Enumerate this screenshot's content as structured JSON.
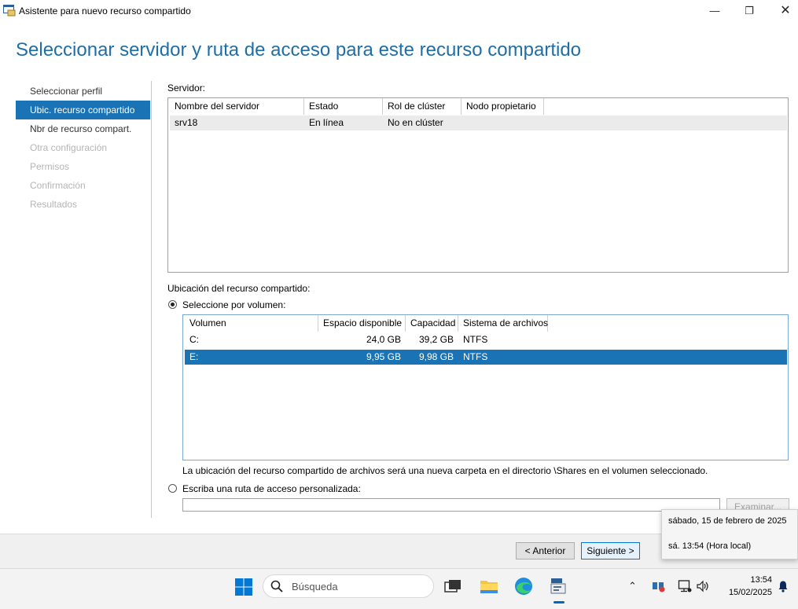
{
  "window": {
    "title": "Asistente para nuevo recurso compartido",
    "controls": {
      "minimize": "—",
      "maximize": "❐",
      "close": "✕"
    }
  },
  "header": {
    "title": "Seleccionar servidor y ruta de acceso para este recurso compartido"
  },
  "nav": {
    "items": [
      {
        "label": "Seleccionar perfil",
        "state": "normal"
      },
      {
        "label": "Ubic. recurso compartido",
        "state": "active"
      },
      {
        "label": "Nbr de recurso compart.",
        "state": "normal"
      },
      {
        "label": "Otra configuración",
        "state": "disabled"
      },
      {
        "label": "Permisos",
        "state": "disabled"
      },
      {
        "label": "Confirmación",
        "state": "disabled"
      },
      {
        "label": "Resultados",
        "state": "disabled"
      }
    ]
  },
  "server": {
    "label": "Servidor:",
    "columns": [
      "Nombre del servidor",
      "Estado",
      "Rol de clúster",
      "Nodo propietario"
    ],
    "rows": [
      [
        "srv18",
        "En línea",
        "No en clúster",
        ""
      ]
    ]
  },
  "location": {
    "label": "Ubicación del recurso compartido:",
    "by_volume_label": "Seleccione por volumen:",
    "by_volume_selected": true,
    "volume_columns": [
      "Volumen",
      "Espacio disponible",
      "Capacidad",
      "Sistema de archivos"
    ],
    "volumes": [
      {
        "volume": "C:",
        "free": "24,0 GB",
        "capacity": "39,2 GB",
        "fs": "NTFS",
        "selected": false
      },
      {
        "volume": "E:",
        "free": "9,95 GB",
        "capacity": "9,98 GB",
        "fs": "NTFS",
        "selected": true
      }
    ],
    "note": "La ubicación del recurso compartido de archivos será una nueva carpeta en el directorio \\Shares en el volumen seleccionado.",
    "custom_path_label": "Escriba una ruta de acceso personalizada:",
    "custom_path_value": "",
    "browse_label": "Examinar..."
  },
  "footer": {
    "prev_label": "< Anterior",
    "next_label": "Siguiente >"
  },
  "tooltip": {
    "line1": "sábado, 15 de febrero de 2025",
    "line2": "sá. 13:54 (Hora local)"
  },
  "taskbar": {
    "search_placeholder": "Búsqueda",
    "clock_time": "13:54",
    "clock_date": "15/02/2025",
    "icons": [
      "start-icon",
      "search-icon",
      "task-view-icon",
      "file-explorer-icon",
      "edge-icon",
      "server-manager-icon",
      "chevron-up-icon",
      "network-icon",
      "display-icon",
      "volume-icon",
      "bell-icon"
    ]
  },
  "colors": {
    "accent": "#1a73b4",
    "title_blue": "#1e6fa8",
    "disabled_text": "#b5b5b5"
  }
}
